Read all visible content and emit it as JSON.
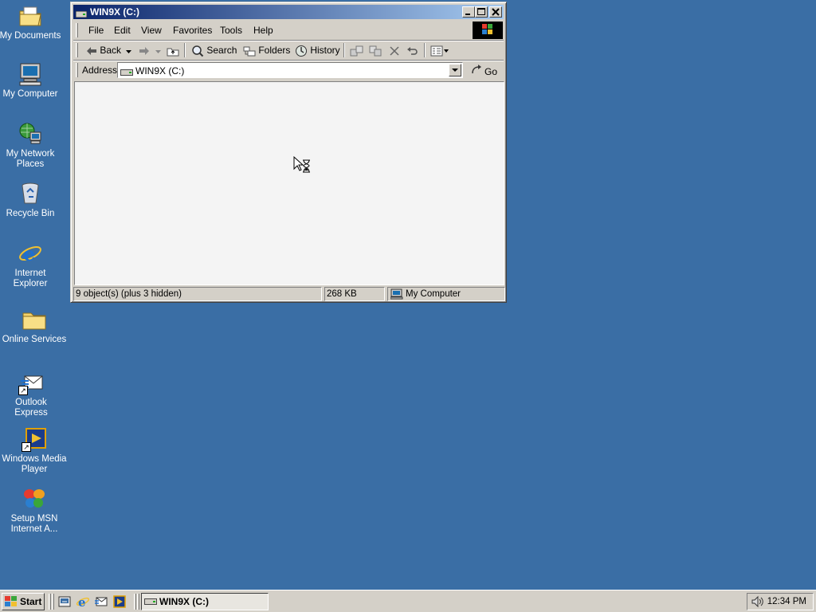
{
  "colors": {
    "desktop": "#3a6ea5",
    "titlebar_start": "#0a246a",
    "titlebar_end": "#a6caf0",
    "chrome": "#d4d0c8"
  },
  "desktop": {
    "icons": [
      {
        "label": "My Documents",
        "icon": "folder-documents-icon"
      },
      {
        "label": "My Computer",
        "icon": "computer-icon"
      },
      {
        "label": "My Network Places",
        "icon": "network-icon"
      },
      {
        "label": "Recycle Bin",
        "icon": "recycle-bin-icon"
      },
      {
        "label": "Internet Explorer",
        "icon": "internet-explorer-icon"
      },
      {
        "label": "Online Services",
        "icon": "folder-icon"
      },
      {
        "label": "Outlook Express",
        "icon": "outlook-express-icon"
      },
      {
        "label": "Windows Media Player",
        "icon": "media-player-icon"
      },
      {
        "label": "Setup MSN Internet A...",
        "icon": "msn-butterfly-icon"
      }
    ]
  },
  "window": {
    "title": "WIN9X (C:)",
    "menu": [
      "File",
      "Edit",
      "View",
      "Favorites",
      "Tools",
      "Help"
    ],
    "toolbar": {
      "back": "Back",
      "search": "Search",
      "folders": "Folders",
      "history": "History"
    },
    "address": {
      "label": "Address",
      "value": "WIN9X (C:)",
      "go": "Go"
    },
    "status": {
      "objects": "9 object(s) (plus 3 hidden)",
      "size": "268 KB",
      "zone": "My Computer"
    }
  },
  "taskbar": {
    "start": "Start",
    "task": "WIN9X (C:)",
    "clock": "12:34 PM"
  }
}
